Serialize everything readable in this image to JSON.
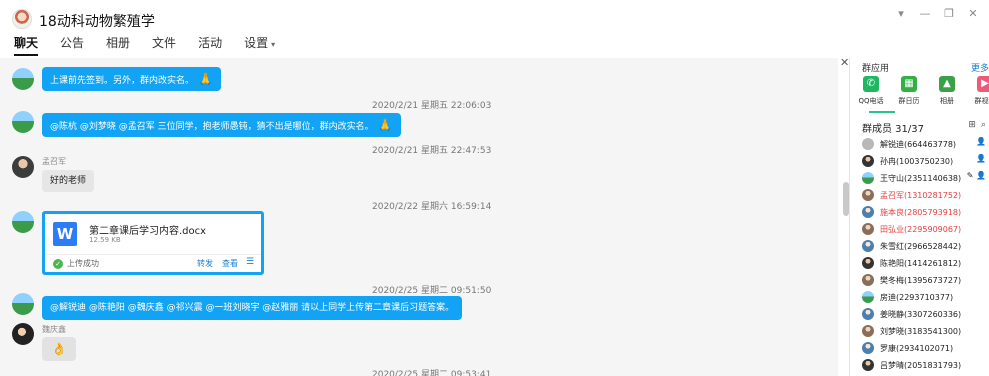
{
  "header": {
    "title": "18动科动物繁殖学",
    "tabs": [
      {
        "label": "聊天"
      },
      {
        "label": "公告"
      },
      {
        "label": "相册"
      },
      {
        "label": "文件"
      },
      {
        "label": "活动"
      },
      {
        "label": "设置"
      }
    ],
    "window_controls": [
      "▾",
      "—",
      "❐",
      "✕"
    ]
  },
  "chat": {
    "messages": [
      {
        "text": "上课前先签到。另外，群内改实名。",
        "emoji": "🙏"
      },
      {
        "time": "2020/2/21 星期五 22:06:03",
        "text": "@陈杭 @刘梦晓 @孟召军 三位同学，抱老师愚钝，猜不出是哪位，群内改实名。",
        "emoji": "🙏"
      },
      {
        "time": "2020/2/21 星期五 22:47:53",
        "sender": "孟召军",
        "text": "好的老师"
      },
      {
        "time": "2020/2/22 星期六 16:59:14"
      },
      {
        "time": "2020/2/25 星期二 09:51:50",
        "text": "@解锐迪 @陈艳阳 @魏庆鑫 @祁兴震 @一班刘晓宇 @赵雅丽 请以上同学上传第二章课后习题答案。"
      },
      {
        "sender": "魏庆鑫",
        "emoji": "👌"
      },
      {
        "time": "2020/2/25 星期二 09:53:41"
      }
    ],
    "file": {
      "icon_letter": "W",
      "name": "第二章课后学习内容.docx",
      "size": "12.59 KB",
      "status": "上传成功",
      "forward": "转发",
      "view": "查看",
      "menu": "☰"
    }
  },
  "side": {
    "apps_title": "群应用",
    "more": "更多",
    "apps": [
      {
        "label": "QQ电话",
        "glyph": "✆"
      },
      {
        "label": "群日历",
        "glyph": "▦"
      },
      {
        "label": "相册",
        "glyph": "▲"
      },
      {
        "label": "群视频",
        "glyph": "▶"
      }
    ],
    "members_title": "群成员 31/37",
    "members": [
      {
        "name": "解锐迪(664463778)",
        "red": false,
        "badge": "👤"
      },
      {
        "name": "孙冉(1003750230)",
        "red": false,
        "badge": "👤"
      },
      {
        "name": "王守山(2351140638)",
        "red": false,
        "badge": "✎ 👤"
      },
      {
        "name": "孟召军(1310281752)",
        "red": true,
        "badge": ""
      },
      {
        "name": "施本良(2805793918)",
        "red": true,
        "badge": ""
      },
      {
        "name": "田弘业(2295909067)",
        "red": true,
        "badge": ""
      },
      {
        "name": "朱雪红(2966528442)",
        "red": false,
        "badge": ""
      },
      {
        "name": "陈艳阳(1414261812)",
        "red": false,
        "badge": ""
      },
      {
        "name": "樊冬梅(1395673727)",
        "red": false,
        "badge": ""
      },
      {
        "name": "房迪(2293710377)",
        "red": false,
        "badge": ""
      },
      {
        "name": "姜晓静(3307260336)",
        "red": false,
        "badge": ""
      },
      {
        "name": "刘梦晓(3183541300)",
        "red": false,
        "badge": ""
      },
      {
        "name": "罗康(2934102071)",
        "red": false,
        "badge": ""
      },
      {
        "name": "吕梦晴(2051831793)",
        "red": false,
        "badge": ""
      }
    ]
  },
  "colors": {
    "bubble_blue": "#12a3f5",
    "member_red": "#e53e3e",
    "link_blue": "#1a7fd6"
  }
}
